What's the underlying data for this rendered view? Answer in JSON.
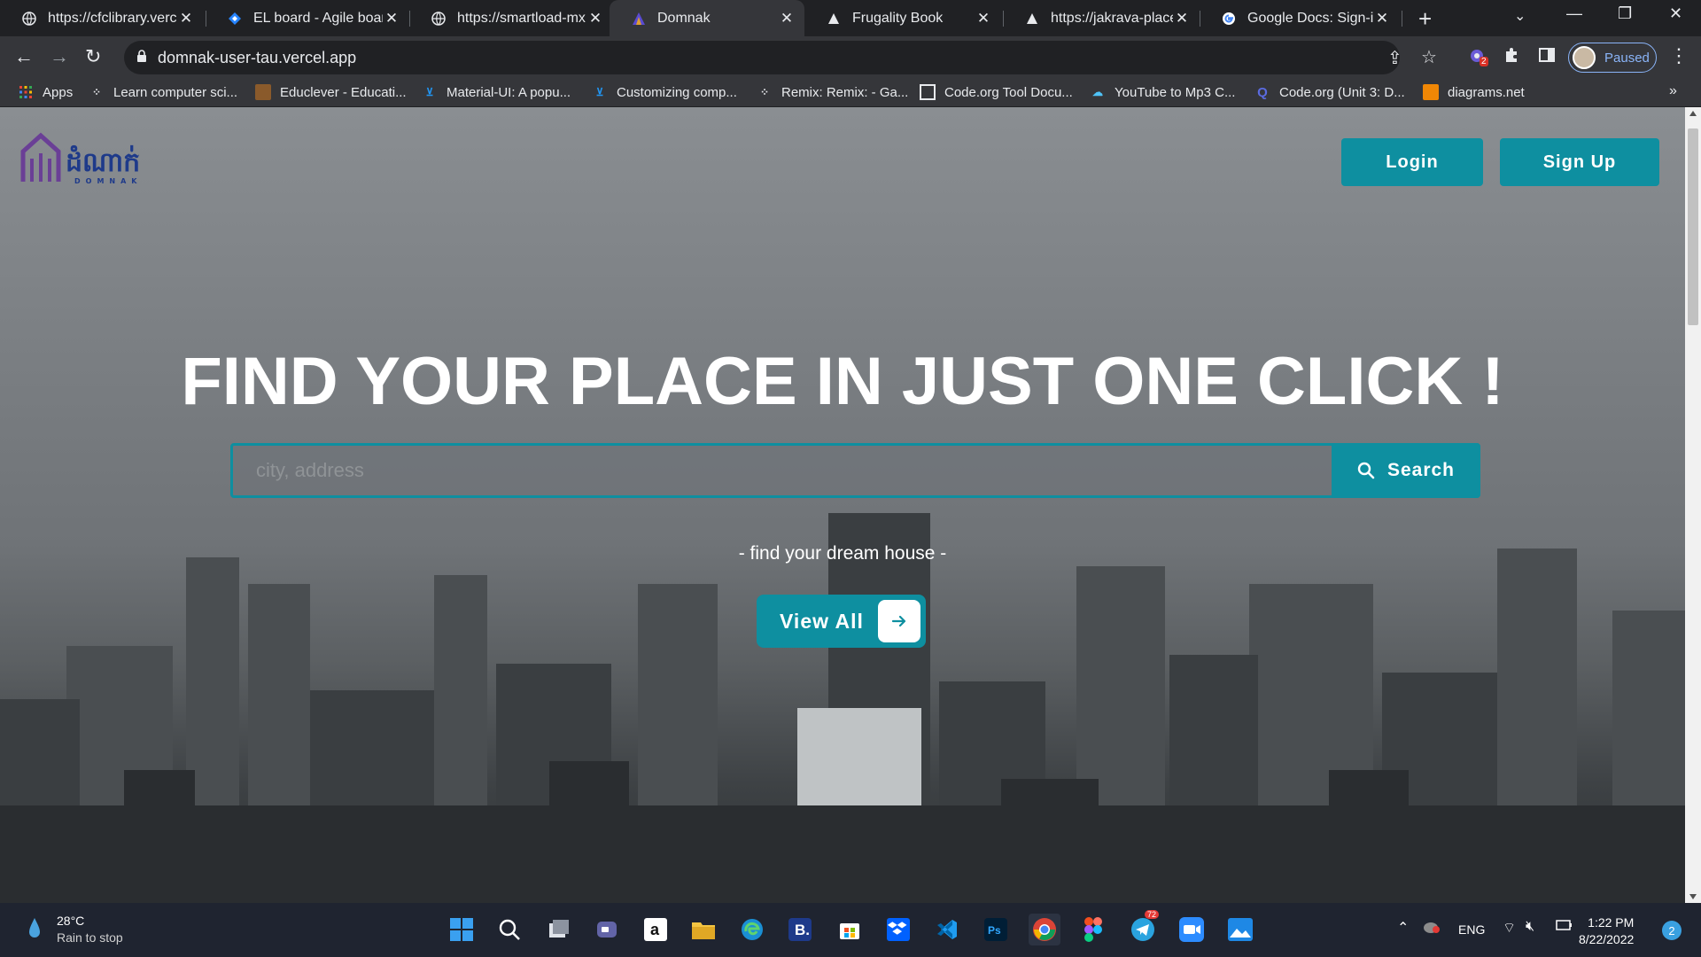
{
  "browser": {
    "tabs": [
      {
        "title": "https://cfclibrary.verce",
        "icon": "globe-icon"
      },
      {
        "title": "EL board - Agile boar",
        "icon": "jira-icon"
      },
      {
        "title": "https://smartload-mx",
        "icon": "globe-icon"
      },
      {
        "title": "Domnak",
        "icon": "domnak-icon",
        "active": true
      },
      {
        "title": "Frugality Book",
        "icon": "triangle-icon"
      },
      {
        "title": "https://jakrava-place.",
        "icon": "triangle-icon"
      },
      {
        "title": "Google Docs: Sign-in",
        "icon": "google-icon"
      }
    ],
    "url": "domnak-user-tau.vercel.app",
    "profile_label": "Paused",
    "extension_badge": "2"
  },
  "bookmarks": [
    {
      "label": "Apps",
      "icon": "apps-grid-icon"
    },
    {
      "label": "Learn computer sci...",
      "icon": "codeorg-icon"
    },
    {
      "label": "Educlever - Educati...",
      "icon": "educlever-icon"
    },
    {
      "label": "Material-UI: A popu...",
      "icon": "mui-icon"
    },
    {
      "label": "Customizing comp...",
      "icon": "mui-icon"
    },
    {
      "label": "Remix: Remix: - Ga...",
      "icon": "codeorg-icon"
    },
    {
      "label": "Code.org Tool Docu...",
      "icon": "codeorg-doc-icon"
    },
    {
      "label": "YouTube to Mp3 C...",
      "icon": "download-icon"
    },
    {
      "label": "Code.org (Unit 3: D...",
      "icon": "q-icon"
    },
    {
      "label": "diagrams.net",
      "icon": "drawio-icon"
    }
  ],
  "page": {
    "logo_text": "ដំណាក់",
    "logo_sub": "DOMNAK",
    "login_label": "Login",
    "signup_label": "Sign Up",
    "hero_title": "FIND YOUR PLACE IN JUST ONE CLICK !",
    "search_placeholder": "city, address",
    "search_button": "Search",
    "tagline": "- find your dream house -",
    "view_all": "View All",
    "accent_color": "#0e8fa0"
  },
  "taskbar": {
    "weather_temp": "28°C",
    "weather_condition": "Rain to stop",
    "language": "ENG",
    "time": "1:22 PM",
    "date": "8/22/2022",
    "notification_count": "2",
    "telegram_badge": "72"
  }
}
